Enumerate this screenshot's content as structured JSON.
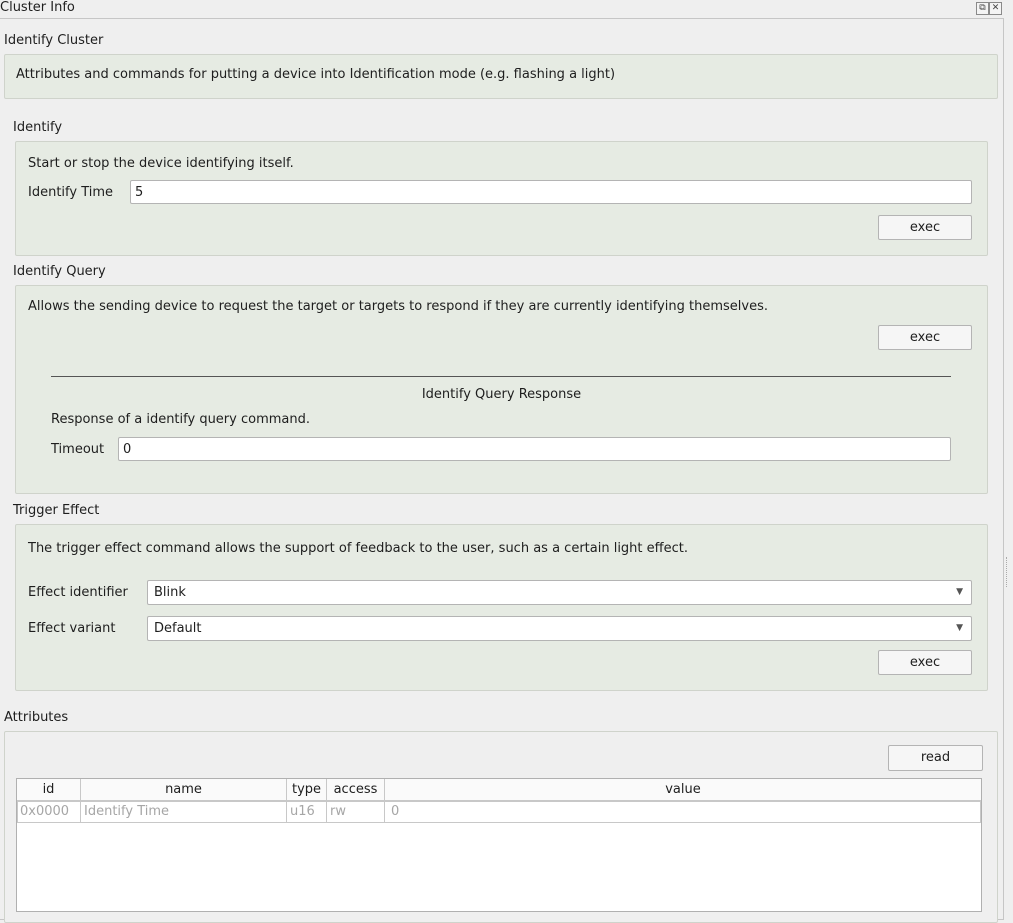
{
  "window": {
    "title": "Cluster Info",
    "float_glyph": "⧉",
    "close_glyph": "✕"
  },
  "cluster": {
    "name": "Identify Cluster",
    "description": "Attributes and commands for putting a device into Identification mode (e.g. flashing a light)"
  },
  "identify": {
    "title": "Identify",
    "description": "Start or stop the device identifying itself.",
    "time_label": "Identify Time",
    "time_value": "5",
    "exec_label": "exec"
  },
  "identify_query": {
    "title": "Identify Query",
    "description": "Allows the sending device to request the target or targets to respond if they are currently identifying themselves.",
    "exec_label": "exec",
    "response": {
      "title": "Identify Query Response",
      "description": "Response of a identify query command.",
      "timeout_label": "Timeout",
      "timeout_value": "0"
    }
  },
  "trigger_effect": {
    "title": "Trigger Effect",
    "description": "The trigger effect command allows the support of feedback to the user, such as a certain light effect.",
    "identifier_label": "Effect identifier",
    "identifier_value": "Blink",
    "variant_label": "Effect variant",
    "variant_value": "Default",
    "exec_label": "exec"
  },
  "attributes": {
    "title": "Attributes",
    "read_label": "read",
    "columns": [
      "id",
      "name",
      "type",
      "access",
      "value"
    ],
    "rows": [
      {
        "id": "0x0000",
        "name": "Identify Time",
        "type": "u16",
        "access": "rw",
        "value": "0"
      }
    ]
  }
}
